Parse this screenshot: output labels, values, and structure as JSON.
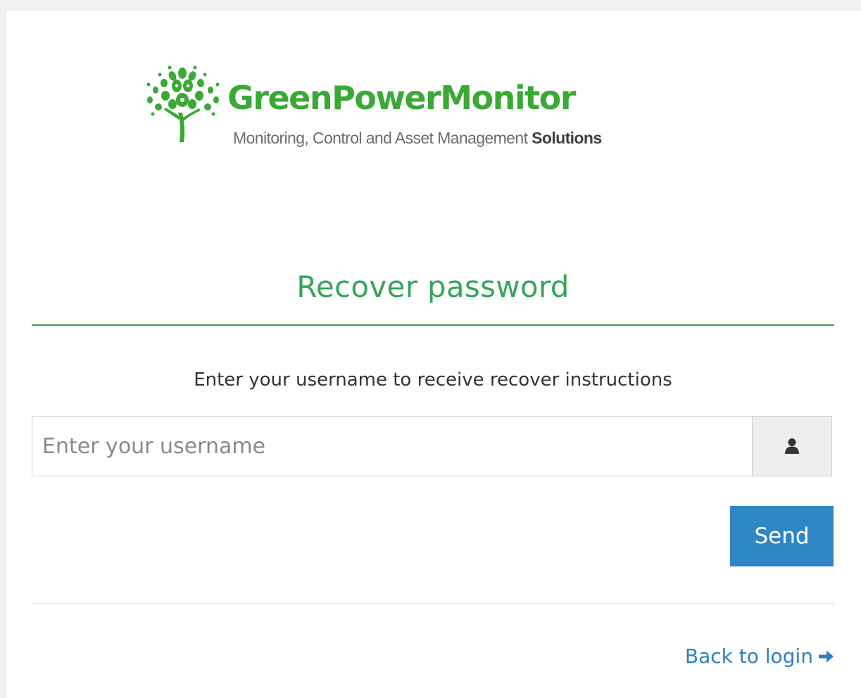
{
  "brand": {
    "name": "GreenPowerMonitor",
    "tagline_regular": "Monitoring, Control and Asset Management",
    "tagline_bold": "Solutions",
    "logo_icon": "tree-icon"
  },
  "form": {
    "title": "Recover password",
    "instructions": "Enter your username to receive recover instructions",
    "username_placeholder": "Enter your username",
    "username_value": "",
    "user_icon": "user-icon",
    "send_label": "Send",
    "back_label": "Back to login",
    "back_icon": "arrow-right-icon"
  },
  "colors": {
    "brand_green": "#3aa935",
    "heading_green": "#36a559",
    "button_blue": "#2f86c5",
    "link_blue": "#2f7fc1"
  }
}
